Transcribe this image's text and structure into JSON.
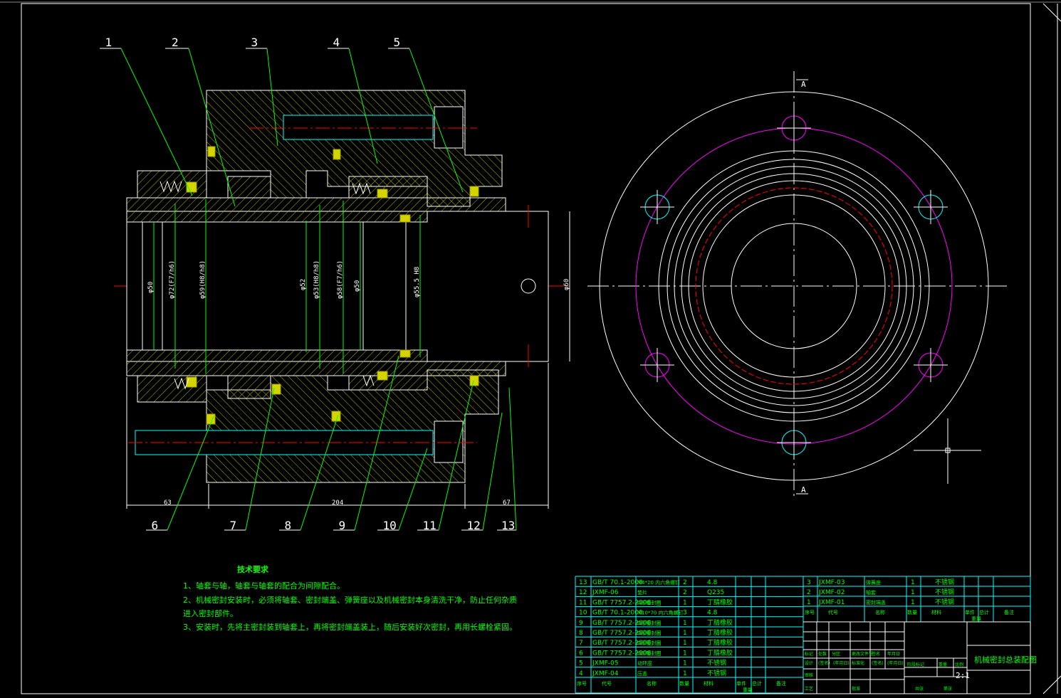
{
  "colors": {
    "background": "#000000",
    "frame": "#ffffff",
    "hatch": "#d4d400",
    "leader": "#00ff00",
    "centerline": "#ff0000",
    "bolt_circle": "#ff00ff",
    "hole": "#00ffff",
    "table_line": "#00ffff"
  },
  "part_labels": [
    "1",
    "2",
    "3",
    "4",
    "5",
    "6",
    "7",
    "8",
    "9",
    "10",
    "11",
    "12",
    "13"
  ],
  "dimensions": {
    "d1": "φ50",
    "d2": "φ72(F7/h6)",
    "d3": "φ59(H8/h8)",
    "d4": "φ52",
    "d5": "φ53(H8/h8)",
    "d6": "φ58(F7/h6)",
    "d7": "φ50",
    "d8": "φ55.5 H8",
    "d9": "φ60",
    "len1": "63",
    "len2": "204",
    "len3": "67"
  },
  "section_marks": {
    "top": "A",
    "bottom": "A"
  },
  "tech": {
    "title": "技术要求",
    "lines": [
      "1、轴套与轴，轴套与轴套的配合为间隙配合。",
      "2、机械密封安装时，必须将轴套、密封端盖、弹簧座以及机械密封本身清洗干净，防止任何杂质",
      "进入密封部件。",
      "3、安装时，先将主密封装到轴套上，再将密封端盖装上，随后安装好次密封，再用长螺栓紧固。"
    ]
  },
  "bom_left": [
    [
      "13",
      "GB/T 70.1-2000",
      "M4*20 内六角螺钉",
      "2",
      "4.8"
    ],
    [
      "12",
      "JXMF-06",
      "垫片",
      "2",
      "Q235"
    ],
    [
      "11",
      "GB/T 7757.2-2006",
      "O形密封圈",
      "1",
      "丁腈橡胶"
    ],
    [
      "10",
      "GB/T 70.1-2000",
      "M10*70 内六角螺钉",
      "3",
      "4.8"
    ],
    [
      "9",
      "GB/T 7757.2-2006",
      "O形密封圈",
      "1",
      "丁腈橡胶"
    ],
    [
      "8",
      "GB/T 7757.2-2006",
      "O形密封圈",
      "1",
      "丁腈橡胶"
    ],
    [
      "7",
      "GB/T 7757.2-2006",
      "O形密封圈",
      "1",
      "丁腈橡胶"
    ],
    [
      "6",
      "GB/T 7757.2-2006",
      "O形密封圈",
      "1",
      "丁腈橡胶"
    ],
    [
      "5",
      "JXMF-05",
      "动环座",
      "1",
      "不锈钢"
    ],
    [
      "4",
      "JXMF-04",
      "压盖",
      "1",
      "不锈钢"
    ]
  ],
  "bom_right": [
    [
      "3",
      "JXMF-03",
      "弹簧座",
      "1",
      "不锈钢"
    ],
    [
      "2",
      "JXMF-02",
      "轴套",
      "1",
      "不锈钢"
    ],
    [
      "1",
      "JXMF-01",
      "密封端盖",
      "1",
      "不锈钢"
    ]
  ],
  "bom_header": [
    "序号",
    "代号",
    "名称",
    "数量",
    "材料",
    "单件",
    "总计",
    "重量",
    "备注"
  ],
  "title_block": {
    "title": "机械密封总装配图",
    "scale": "2:1",
    "labels": [
      "标记",
      "处数",
      "分区",
      "更改文件号",
      "签名",
      "年月日",
      "设计",
      "(签名)",
      "(年月日)",
      "标准化",
      "(签名)",
      "(年月日)",
      "审核",
      "工艺",
      "批准",
      "阶段标记",
      "重量",
      "比例",
      "共张",
      "第张"
    ]
  }
}
